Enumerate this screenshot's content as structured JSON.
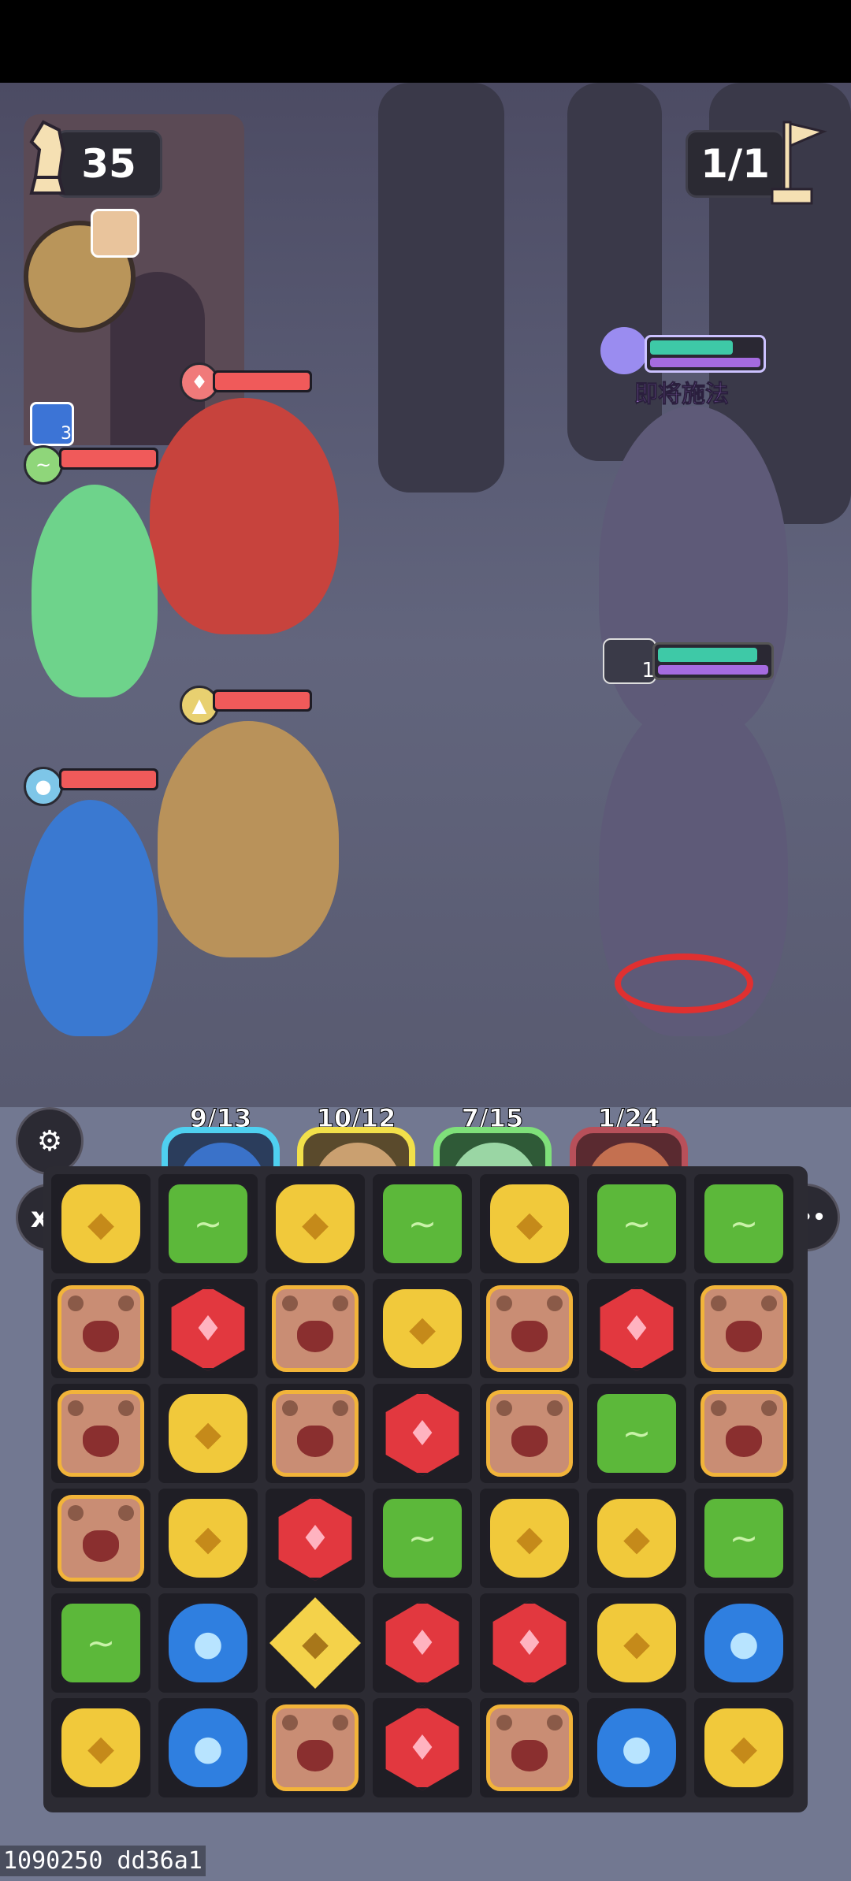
{
  "hud": {
    "moves_left": "35",
    "wave": "1/1"
  },
  "enemies": {
    "status_text": "即将施法",
    "cooldown": "1"
  },
  "heroes": [
    {
      "charge": "9/13",
      "element": "water",
      "color": "#4fd0f0"
    },
    {
      "charge": "10/12",
      "element": "earth",
      "color": "#f2e04a"
    },
    {
      "charge": "7/15",
      "element": "wind",
      "color": "#7fe07a"
    },
    {
      "charge": "1/24",
      "element": "fire",
      "color": "#b8505a"
    }
  ],
  "buttons": {
    "speed": "x3",
    "more": "•••"
  },
  "board": [
    [
      "yellow",
      "green",
      "yellow",
      "green",
      "yellow",
      "green",
      "green"
    ],
    [
      "bear",
      "red",
      "bear",
      "yellow",
      "bear",
      "red",
      "bear"
    ],
    [
      "bear",
      "yellow",
      "bear",
      "red",
      "bear",
      "green",
      "bear"
    ],
    [
      "bear",
      "yellow",
      "red",
      "green",
      "yellow",
      "yellow",
      "green"
    ],
    [
      "green",
      "blue",
      "gold",
      "red",
      "red",
      "yellow",
      "blue"
    ],
    [
      "yellow",
      "blue",
      "bear",
      "red",
      "bear",
      "blue",
      "yellow"
    ]
  ],
  "debug_text": "1090250 dd36a1",
  "ally_badge": "3"
}
